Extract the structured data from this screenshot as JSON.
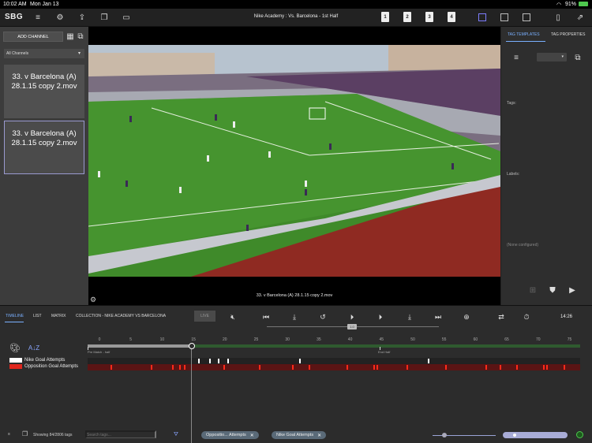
{
  "status_bar": {
    "time": "10:02 AM",
    "date": "Mon Jan 13",
    "battery": "91%"
  },
  "toolbar": {
    "logo": "SBG",
    "title": "Nike Academy : Vs. Barcelona - 1st Half",
    "half_buttons": [
      "1",
      "2",
      "3",
      "4"
    ]
  },
  "left_panel": {
    "add_channel_label": "ADD CHANNEL",
    "channel_filter": "All Channels",
    "clips": [
      {
        "line1": "33. v Barcelona (A)",
        "line2": "28.1.15 copy 2.mov"
      },
      {
        "line1": "33. v Barcelona (A)",
        "line2": "28.1.15 copy 2.mov"
      }
    ]
  },
  "video": {
    "caption": "33. v Barcelona (A) 28.1.15 copy 2.mov"
  },
  "right_panel": {
    "tabs": [
      "TAG TEMPLATES",
      "TAG PROPERTIES"
    ],
    "tags_label": "Tags:",
    "labels_label": "Labels:",
    "none_configured": "(None configured)"
  },
  "bottom": {
    "tabs": [
      "TIMELINE",
      "LIST",
      "MATRIX",
      "COLLECTION - NIKE ACADEMY VS BARCELONA"
    ],
    "live_label": "LIVE",
    "timecode": "14:26",
    "speed_label": "1.0",
    "ticks": [
      "0",
      "5",
      "10",
      "15",
      "20",
      "25",
      "30",
      "35",
      "40",
      "45",
      "50",
      "55",
      "60",
      "65",
      "70",
      "75"
    ],
    "periods": [
      "Pre Match - half",
      "End Half"
    ],
    "rows": [
      {
        "label": "Nike Goal Attempts",
        "color": "#ffffff",
        "events": [
          16.5,
          18.3,
          19.6,
          21.1,
          32.6,
          53.1
        ]
      },
      {
        "label": "Opposition Goal Attempts",
        "color": "#e0261d",
        "events": [
          2.5,
          9.0,
          12.4,
          13.5,
          14.2,
          20.5,
          26.2,
          31.5,
          34.1,
          40.2,
          44.5,
          45.0,
          49.8,
          55.9,
          62.3,
          64.6,
          67.3,
          71.6,
          72.1,
          74.8
        ]
      }
    ],
    "tag_count": "Showing 84/2806 tags",
    "search_placeholder": "Search tags...",
    "filter_chips": [
      "Oppositio... Attempts",
      "Nike Goal Attempts"
    ]
  }
}
